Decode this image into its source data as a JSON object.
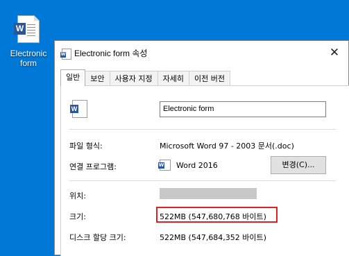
{
  "desktop": {
    "icon_label_line1": "Electronic",
    "icon_label_line2": "form",
    "icon": "word-document-icon"
  },
  "dialog": {
    "title": "Electronic form 속성",
    "close_glyph": "✕",
    "tabs": [
      {
        "label": "일반",
        "active": true
      },
      {
        "label": "보안",
        "active": false
      },
      {
        "label": "사용자 지정",
        "active": false
      },
      {
        "label": "자세히",
        "active": false
      },
      {
        "label": "이전 버전",
        "active": false
      }
    ],
    "file_name": "Electronic form",
    "rows": {
      "file_type_label": "파일 형식:",
      "file_type_value": "Microsoft Word 97 - 2003 문서(.doc)",
      "open_with_label": "연결 프로그램:",
      "open_with_value": "Word 2016",
      "change_button": "변경(C)...",
      "location_label": "위치:",
      "size_label": "크기:",
      "size_value": "522MB (547,680,768 바이트)",
      "size_on_disk_label": "디스크 할당 크기:",
      "size_on_disk_value": "522MB (547,684,352 바이트)"
    },
    "highlight_color": "#e02020",
    "accent_color": "#2b579a"
  }
}
